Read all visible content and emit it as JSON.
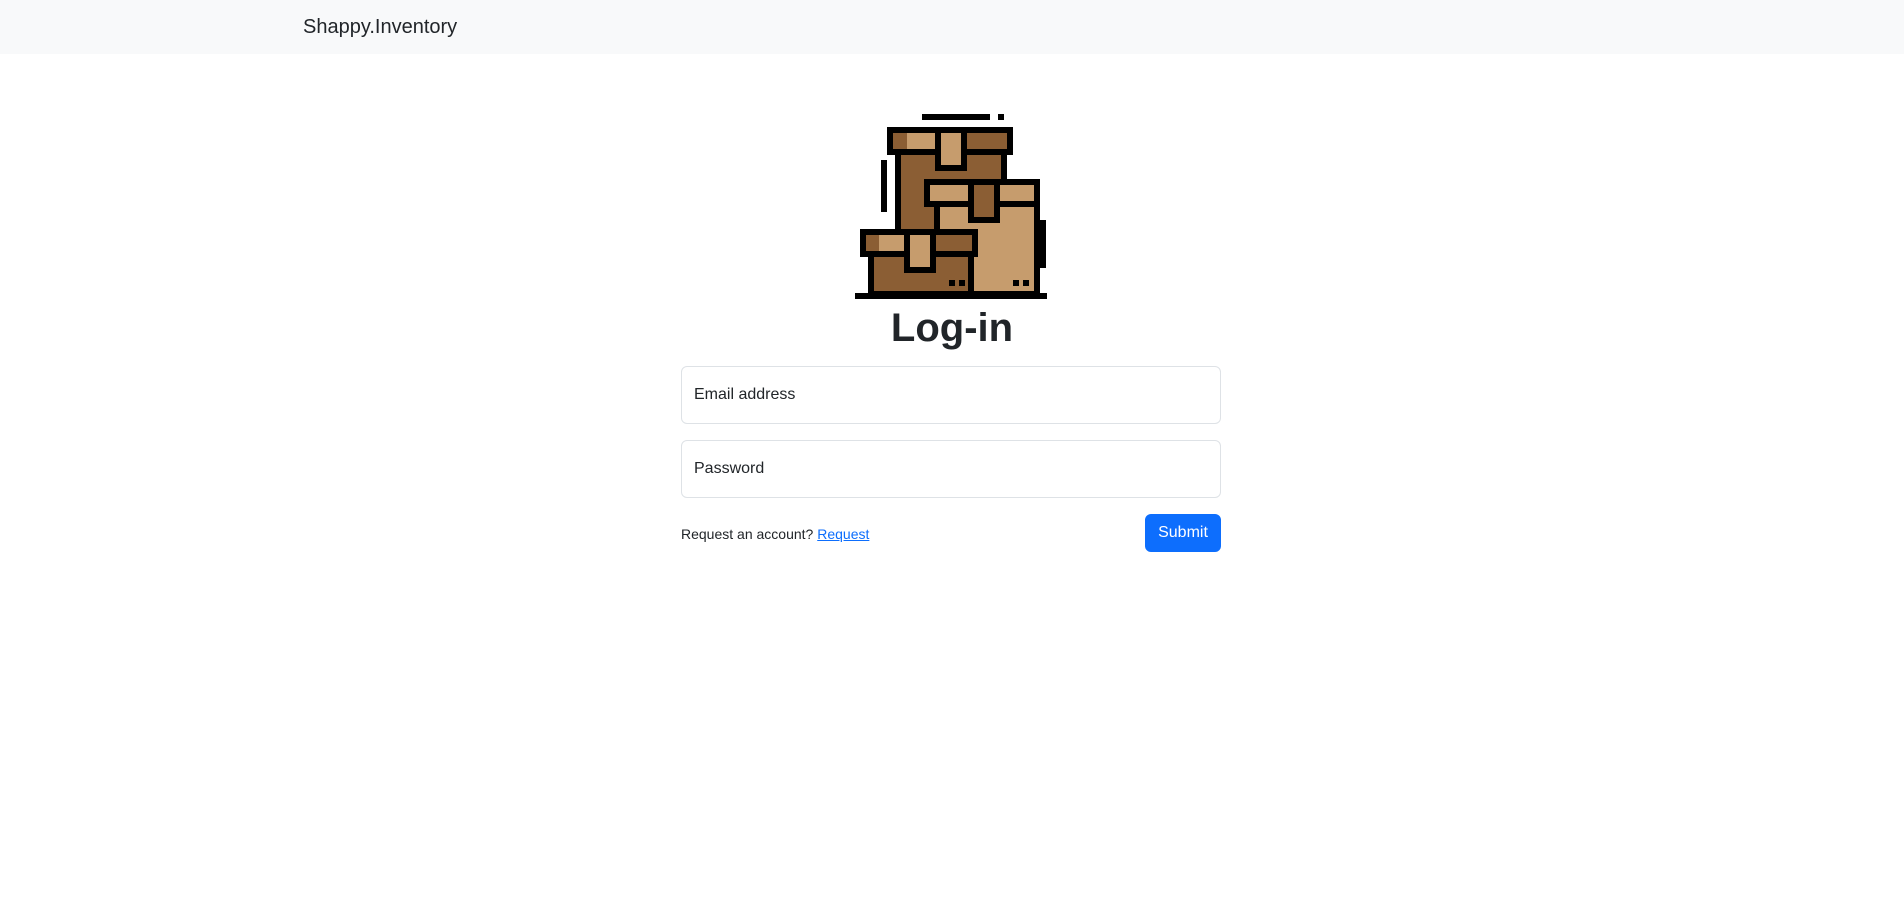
{
  "navbar": {
    "brand": "Shappy.Inventory"
  },
  "logo": {
    "icon": "boxes-icon",
    "colors": {
      "dark_box": "#8b5e34",
      "light_box": "#c69c6d",
      "outline": "#000000"
    }
  },
  "login": {
    "title": "Log-in",
    "email_placeholder": "Email address",
    "password_placeholder": "Password",
    "request_text": "Request an account?",
    "request_link": "Request",
    "submit_label": "Submit"
  },
  "colors": {
    "navbar_bg": "#f8f9fa",
    "primary": "#0d6efd",
    "field_border": "#dee2e6"
  }
}
